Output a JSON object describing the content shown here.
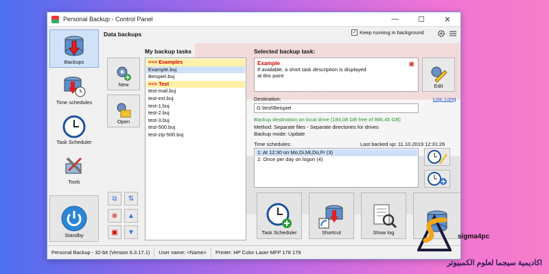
{
  "window": {
    "title": "Personal Backup - Control Panel",
    "controls": {
      "minimize": "—",
      "maximize": "☐",
      "close": "✕"
    }
  },
  "sidebar": {
    "items": [
      {
        "label": "Backups",
        "icon": "database-backup-icon"
      },
      {
        "label": "Time schedules",
        "icon": "clock-database-icon"
      },
      {
        "label": "Task Scheduler",
        "icon": "clock-icon"
      },
      {
        "label": "Tools",
        "icon": "tools-icon"
      }
    ],
    "standby": {
      "label": "Standby",
      "icon": "power-icon"
    }
  },
  "header": {
    "title": "Data backups",
    "keep_running": "Keep running in background",
    "keep_running_checked": true
  },
  "tasks": {
    "heading": "My backup tasks",
    "items": [
      {
        "text": "==> Examples",
        "group": true
      },
      {
        "text": "Example.buj",
        "selected": true
      },
      {
        "text": "Beispiel.buj"
      },
      {
        "text": "==> Test",
        "group": true
      },
      {
        "text": "test-mail.buj"
      },
      {
        "text": "test-ext.buj"
      },
      {
        "text": "test-1.buj"
      },
      {
        "text": "test-2.buj"
      },
      {
        "text": "test-3.buj"
      },
      {
        "text": "test-500.buj"
      },
      {
        "text": "test-zip-500.buj"
      }
    ],
    "new_label": "New",
    "open_label": "Open"
  },
  "selected": {
    "heading": "Selected backup task:",
    "name": "Example",
    "description": "If available, a short task description is displayed at this point",
    "edit_label": "Edit",
    "destination_label": "Destination:",
    "log_link": "Log: Long",
    "destination": "G:\\test\\Beispiel",
    "drive_info": "Backup destination on local drive (184,08 GB free of 886,45 GB)",
    "method": "Method: Separate files - Separate directories for drives",
    "mode": "Backup mode: Update",
    "schedules_label": "Time schedules:",
    "last_backed": "Last backed up: 11.10.2019 12:31:26",
    "schedules": [
      {
        "text": "1: At 12:30 on Mo,Di,Mi,Do,Fr (3)",
        "selected": true
      },
      {
        "text": "2: Once per day on logon (4)"
      }
    ]
  },
  "actions": {
    "task_scheduler": "Task Scheduler",
    "shortcut": "Shortcut",
    "show_log": "Show log"
  },
  "status": {
    "version": "Personal Backup - 32-bit (Version 6.3.17.1)",
    "user": "User name: <Name>",
    "printer": "Printer: HP Color Laser MFP 178 179"
  },
  "watermark": {
    "brand": "sigma4pc",
    "tagline": "اكاديمية سيجما لعلوم الكمبيوتر"
  },
  "colors": {
    "accent": "#2e6fd8",
    "group_text": "#d20000",
    "group_bg": "#fff1a8",
    "selected_bg": "#cfe0f8",
    "green": "#239a2c"
  }
}
